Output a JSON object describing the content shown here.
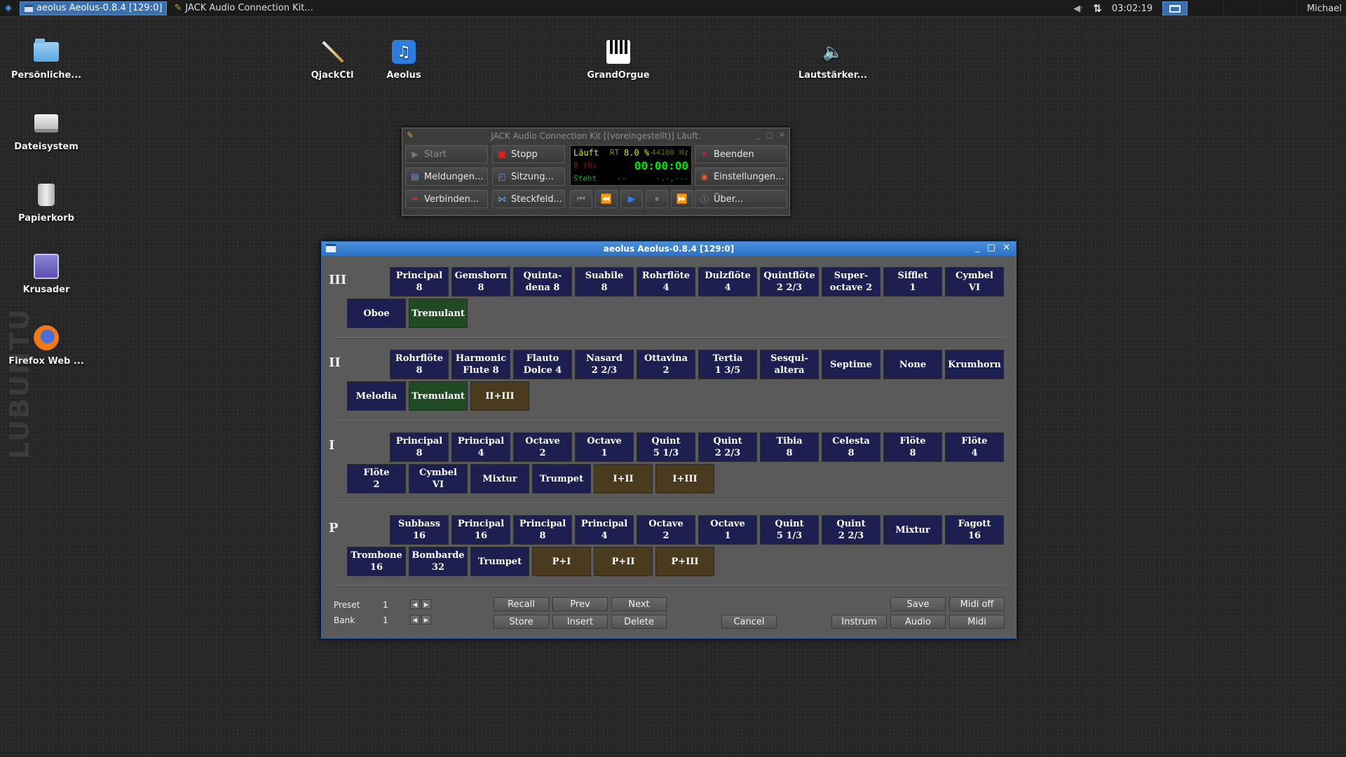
{
  "taskbar": {
    "tasks": [
      "aeolus  Aeolus-0.8.4  [129:0]",
      "JACK Audio Connection Kit..."
    ],
    "clock": "03:02:19",
    "user": "Michael"
  },
  "desktop": {
    "icons": [
      "Persönliche...",
      "Dateisystem",
      "Papierkorb",
      "Krusader",
      "Firefox Web ...",
      "QjackCtl",
      "Aeolus",
      "GrandOrgue",
      "Lautstärker..."
    ]
  },
  "jack": {
    "title": "JACK Audio Connection Kit [(voreingestellt)] Läuft.",
    "buttons": {
      "start": "Start",
      "stopp": "Stopp",
      "beenden": "Beenden",
      "meldungen": "Meldungen...",
      "sitzung": "Sitzung...",
      "einstellungen": "Einstellungen...",
      "verbinden": "Verbinden...",
      "steckfeld": "Steckfeld...",
      "ueber": "Über..."
    },
    "display": {
      "state": "Läuft",
      "rt": "RT",
      "dsp": "8.0 %",
      "rate": "44100 Hz",
      "xruns": "0 (0)",
      "time": "00:00:00",
      "transport": "Steht",
      "dash": "--",
      "bbt": "-.-.---"
    }
  },
  "aeolus": {
    "title": "aeolus  Aeolus-0.8.4  [129:0]",
    "divisions": [
      {
        "label": "III",
        "row1": [
          "Principal\n8",
          "Gemshorn\n8",
          "Quinta-\ndena 8",
          "Suabile\n8",
          "Rohrflöte\n4",
          "Dulzflöte\n4",
          "Quintflöte\n2 2/3",
          "Super-\noctave 2",
          "Sifflet\n1",
          "Cymbel\nVI"
        ],
        "row2": [
          [
            "Oboe",
            "reg"
          ],
          [
            "Tremulant",
            "trem"
          ]
        ]
      },
      {
        "label": "II",
        "row1": [
          "Rohrflöte\n8",
          "Harmonic\nFlute 8",
          "Flauto\nDolce 4",
          "Nasard\n2 2/3",
          "Ottavina\n2",
          "Tertia\n1 3/5",
          "Sesqui-\naltera",
          "Septime",
          "None",
          "Krumhorn"
        ],
        "row2": [
          [
            "Melodia",
            "reg"
          ],
          [
            "Tremulant",
            "trem"
          ],
          [
            "II+III",
            "coup"
          ]
        ]
      },
      {
        "label": "I",
        "row1": [
          "Principal\n8",
          "Principal\n4",
          "Octave\n2",
          "Octave\n1",
          "Quint\n5 1/3",
          "Quint\n2 2/3",
          "Tibia\n8",
          "Celesta\n8",
          "Flöte\n8",
          "Flöte\n4"
        ],
        "row2": [
          [
            "Flöte\n2",
            "reg"
          ],
          [
            "Cymbel\nVI",
            "reg"
          ],
          [
            "Mixtur",
            "reg"
          ],
          [
            "Trumpet",
            "reg"
          ],
          [
            "I+II",
            "coup"
          ],
          [
            "I+III",
            "coup"
          ]
        ]
      },
      {
        "label": "P",
        "row1": [
          "Subbass\n16",
          "Principal\n16",
          "Principal\n8",
          "Principal\n4",
          "Octave\n2",
          "Octave\n1",
          "Quint\n5 1/3",
          "Quint\n2 2/3",
          "Mixtur",
          "Fagott\n16"
        ],
        "row2": [
          [
            "Trombone\n16",
            "reg"
          ],
          [
            "Bombarde\n32",
            "reg"
          ],
          [
            "Trumpet",
            "reg"
          ],
          [
            "P+I",
            "coup"
          ],
          [
            "P+II",
            "coup"
          ],
          [
            "P+III",
            "coup"
          ]
        ]
      }
    ],
    "preset": {
      "label": "Preset",
      "value": "1"
    },
    "bank": {
      "label": "Bank",
      "value": "1"
    },
    "buttons": {
      "recall": "Recall",
      "prev": "Prev",
      "next": "Next",
      "store": "Store",
      "insert": "Insert",
      "delete": "Delete",
      "cancel": "Cancel",
      "save": "Save",
      "midi_off": "Midi off",
      "instrum": "Instrum",
      "audio": "Audio",
      "midi": "Midi"
    }
  }
}
